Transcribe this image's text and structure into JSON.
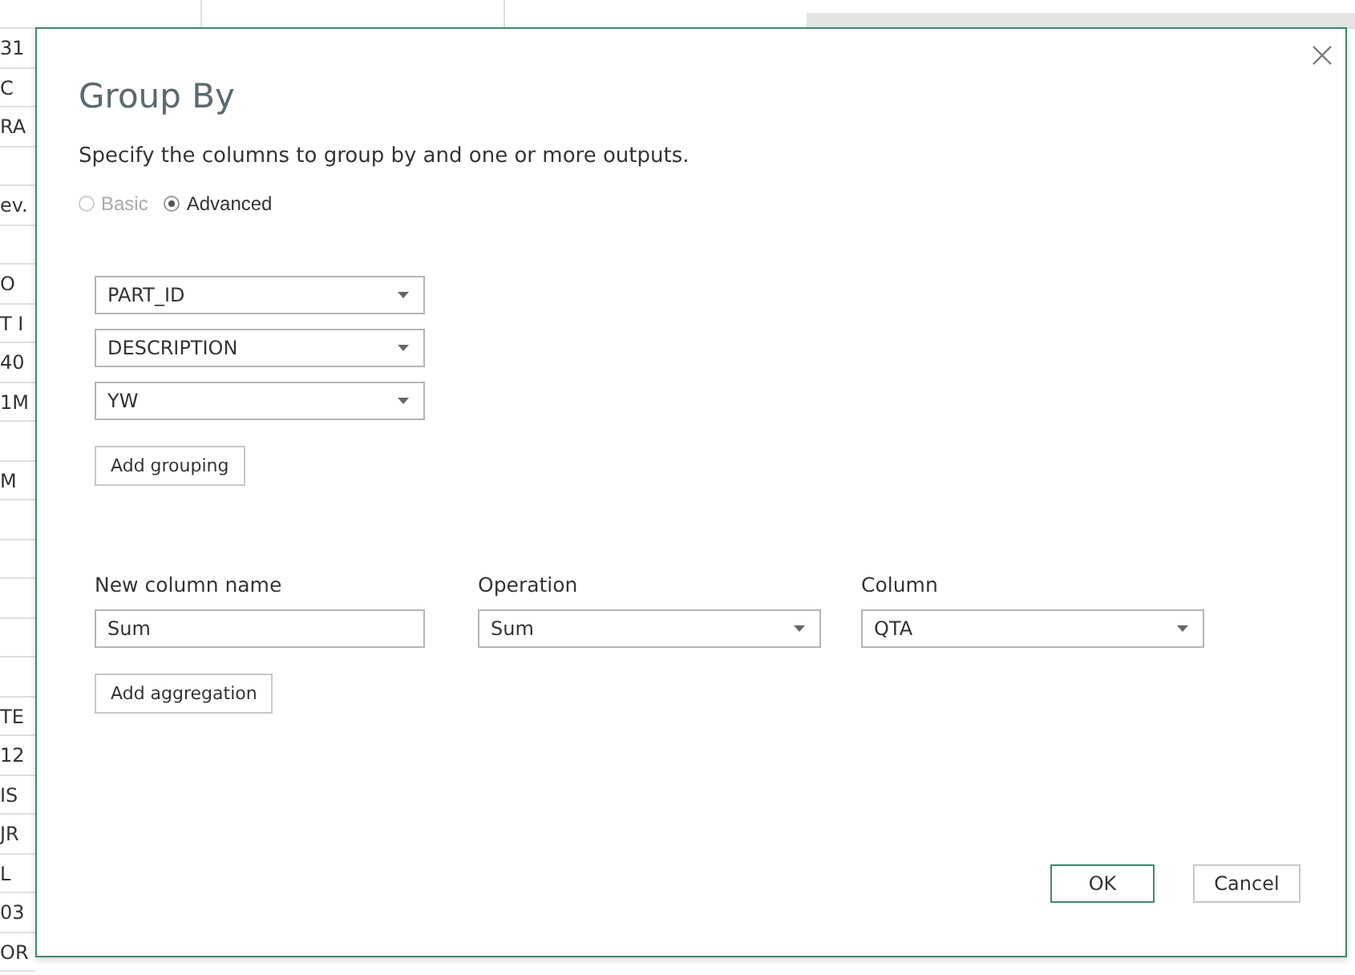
{
  "sheet": {
    "cells": [
      {
        "text": "31"
      },
      {
        "text": "C"
      },
      {
        "text": "RA"
      },
      {},
      {
        "text": "ev."
      },
      {},
      {
        "text": "O"
      },
      {
        "text": "T I"
      },
      {
        "text": "40"
      },
      {
        "text": "1M"
      },
      {},
      {
        "text": "M"
      },
      {},
      {},
      {},
      {},
      {},
      {
        "text": "TE"
      },
      {
        "text": "12"
      },
      {
        "text": "IS"
      },
      {
        "text": "JR"
      },
      {
        "text": "L"
      },
      {
        "text": "03"
      },
      {
        "text": "OR"
      }
    ]
  },
  "dialog": {
    "title": "Group By",
    "subtitle": "Specify the columns to group by and one or more outputs.",
    "modes": [
      {
        "label": "Basic",
        "selected": false,
        "disabled": true
      },
      {
        "label": "Advanced",
        "selected": true,
        "disabled": false
      }
    ],
    "groupings": [
      "PART_ID",
      "DESCRIPTION",
      "YW"
    ],
    "add_grouping": "Add grouping",
    "aggregation": {
      "headers": [
        "New column name",
        "Operation",
        "Column"
      ],
      "new_column_name": "Sum",
      "operation": "Sum",
      "column": "QTA"
    },
    "add_aggregation": "Add aggregation",
    "buttons": [
      {
        "label": "OK",
        "kind": "primary"
      },
      {
        "label": "Cancel",
        "kind": "secondary"
      }
    ]
  }
}
